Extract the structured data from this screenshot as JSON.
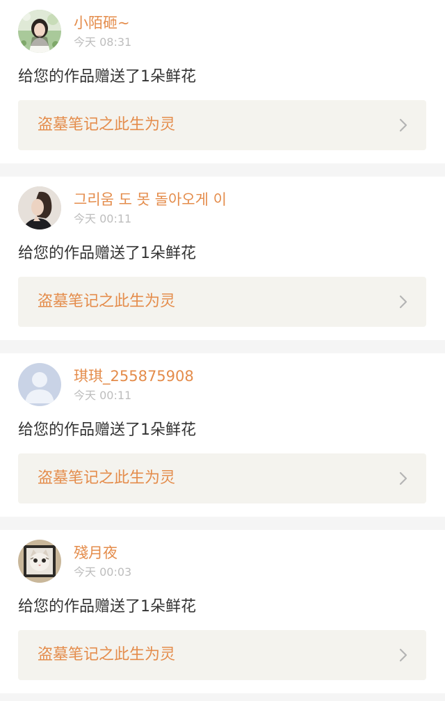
{
  "notifications": [
    {
      "avatar_icon": "girl-photo-avatar",
      "username": "小陌砸~",
      "time": "今天 08:31",
      "message": "给您的作品赠送了1朵鲜花",
      "work_title": "盗墓笔记之此生为灵",
      "chevron_icon": "chevron-right-icon"
    },
    {
      "avatar_icon": "woman-profile-avatar",
      "username": "그리움 도 못 돌아오게 이",
      "time": "今天 00:11",
      "message": "给您的作品赠送了1朵鲜花",
      "work_title": "盗墓笔记之此生为灵",
      "chevron_icon": "chevron-right-icon"
    },
    {
      "avatar_icon": "default-user-avatar",
      "username": "琪琪_255875908",
      "time": "今天 00:11",
      "message": "给您的作品赠送了1朵鲜花",
      "work_title": "盗墓笔记之此生为灵",
      "chevron_icon": "chevron-right-icon"
    },
    {
      "avatar_icon": "cat-photo-avatar",
      "username": "殘月夜",
      "time": "今天 00:03",
      "message": "给您的作品赠送了1朵鲜花",
      "work_title": "盗墓笔记之此生为灵",
      "chevron_icon": "chevron-right-icon"
    }
  ],
  "colors": {
    "accent": "#e48c4b",
    "time_text": "#bdbdbd",
    "body_text": "#333333",
    "link_background": "#f4f3ee",
    "page_background": "#f5f5f5"
  }
}
